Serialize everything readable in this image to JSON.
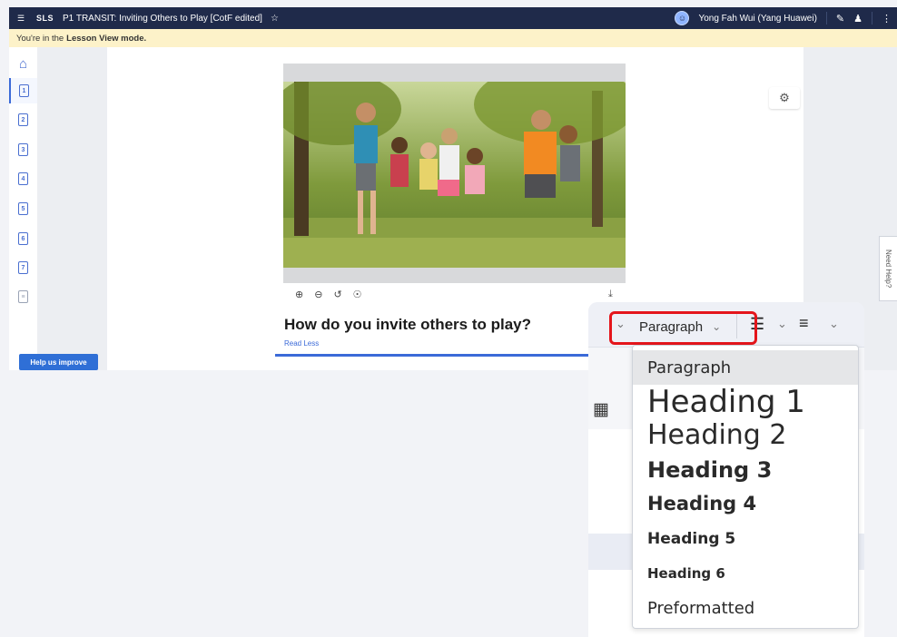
{
  "topbar": {
    "sls_label": "SLS",
    "lesson_title": "P1 TRANSIT: Inviting Others to Play [CotF edited]",
    "user_name": "Yong Fah Wui (Yang Huawei)"
  },
  "banner": {
    "prefix": "You're in the",
    "mode": "Lesson View mode."
  },
  "rail": {
    "pages": [
      "1",
      "2",
      "3",
      "4",
      "5",
      "6",
      "7"
    ]
  },
  "help_button": "Help us improve",
  "content": {
    "headline": "How do you invite others to play?",
    "read_less": "Read Less"
  },
  "need_help": "Need Help?",
  "editor": {
    "format_select": "Paragraph",
    "format_options": [
      "Paragraph",
      "Heading 1",
      "Heading 2",
      "Heading 3",
      "Heading 4",
      "Heading 5",
      "Heading 6",
      "Preformatted"
    ],
    "selected_option": "Paragraph"
  },
  "colors": {
    "topbar_bg": "#1f2a4a",
    "banner_bg": "#fdf2c9",
    "accent": "#3b6ad8",
    "highlight_box": "#e4151b",
    "help_button_bg": "#2f6fd6"
  }
}
